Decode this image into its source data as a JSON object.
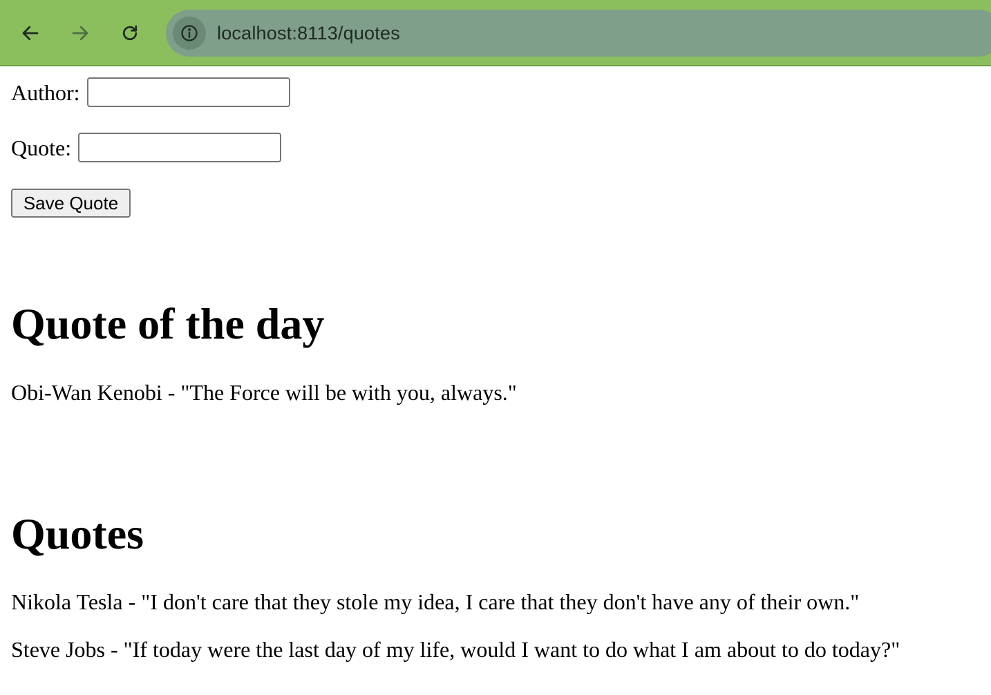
{
  "browser": {
    "url": "localhost:8113/quotes",
    "back_icon": "arrow-left-icon",
    "forward_icon": "arrow-right-icon",
    "reload_icon": "reload-icon",
    "site_info_icon": "info-icon",
    "toolbar_color": "#8bbf5e",
    "omnibox_color": "#7f9f8a"
  },
  "form": {
    "author_label": "Author:",
    "author_value": "",
    "quote_label": "Quote:",
    "quote_value": "",
    "save_label": "Save Quote"
  },
  "quote_of_the_day": {
    "heading": "Quote of the day",
    "text": "Obi-Wan Kenobi - \"The Force will be with you, always.\""
  },
  "quotes": {
    "heading": "Quotes",
    "items": [
      "Nikola Tesla - \"I don't care that they stole my idea, I care that they don't have any of their own.\"",
      "Steve Jobs - \"If today were the last day of my life, would I want to do what I am about to do today?\""
    ]
  }
}
